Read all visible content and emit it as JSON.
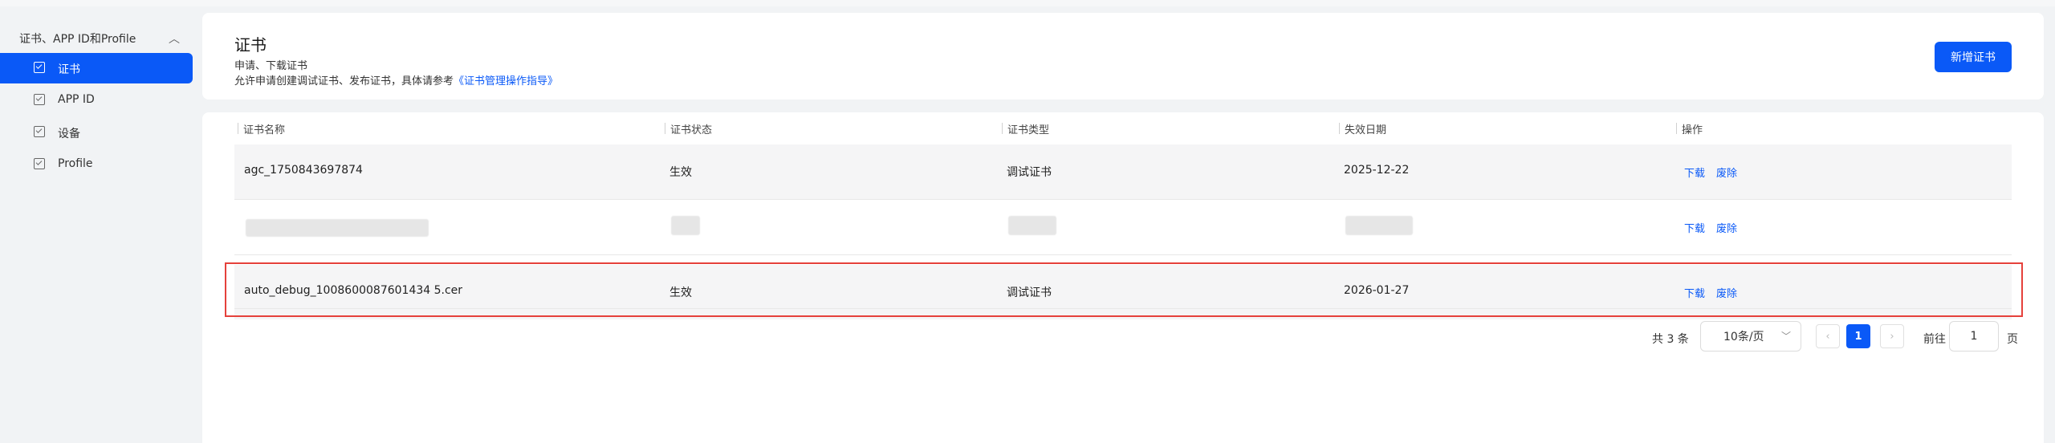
{
  "sidebar": {
    "group_label": "证书、APP ID和Profile",
    "items": [
      {
        "label": "证书",
        "active": true
      },
      {
        "label": "APP ID",
        "active": false
      },
      {
        "label": "设备",
        "active": false
      },
      {
        "label": "Profile",
        "active": false
      }
    ]
  },
  "header": {
    "title": "证书",
    "subtitle": "申请、下载证书",
    "description_prefix": "允许申请创建调试证书、发布证书，具体请参考",
    "guide_link": "《证书管理操作指导》",
    "new_button": "新增证书"
  },
  "table": {
    "columns": [
      "证书名称",
      "证书状态",
      "证书类型",
      "失效日期",
      "操作"
    ],
    "rows": [
      {
        "name": "agc_1750843697874",
        "status": "生效",
        "type": "调试证书",
        "expiry": "2025-12-22",
        "download": "下载",
        "revoke": "废除"
      },
      {
        "name": "",
        "status": "",
        "type": "",
        "expiry": "",
        "download": "下载",
        "revoke": "废除",
        "redacted": true
      },
      {
        "name": "auto_debug_1008600087601434 5.cer",
        "status": "生效",
        "type": "调试证书",
        "expiry": "2026-01-27",
        "download": "下载",
        "revoke": "废除",
        "highlighted": true
      }
    ]
  },
  "pagination": {
    "total": "共 3 条",
    "page_size": "10条/页",
    "prev": "‹",
    "current": "1",
    "next": "›",
    "goto_label": "前往",
    "goto_value": "1",
    "page_suffix": "页"
  },
  "colors": {
    "accent": "#0a59f7",
    "highlight_border": "#e5413b"
  }
}
